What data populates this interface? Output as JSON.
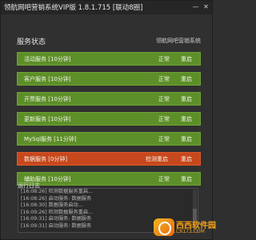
{
  "window": {
    "title": "领航网吧营销系统VIP版 1.8.1.715 [联动8圈]",
    "minimize_glyph": "—",
    "close_glyph": "✕"
  },
  "header": {
    "section_title": "服务状态",
    "brand_label": "领航网吧营销系统"
  },
  "services": [
    {
      "name": "活动服务 [10分钟]",
      "status": "正常",
      "restart": "重启",
      "alert": false
    },
    {
      "name": "客户服务 [10分钟]",
      "status": "正常",
      "restart": "重启",
      "alert": false
    },
    {
      "name": "开票服务 [10分钟]",
      "status": "正常",
      "restart": "重启",
      "alert": false
    },
    {
      "name": "更新服务 [10分钟]",
      "status": "正常",
      "restart": "重启",
      "alert": false
    },
    {
      "name": "MySql服务 [11分钟]",
      "status": "正常",
      "restart": "重启",
      "alert": false
    },
    {
      "name": "数据服务 [0分钟]",
      "status": "检测重启",
      "restart": "重启",
      "alert": true
    },
    {
      "name": "辅助服务 [10分钟]",
      "status": "正常",
      "restart": "重启",
      "alert": false
    }
  ],
  "log": {
    "title": "运行日志",
    "lines": [
      "[16:08:26] 检测数据服务重启...",
      "[16:08:26] 启动服务: 数据服务",
      "[16:08:30] 数据服务启动...",
      "[16:09:26] 检测数据服务重启...",
      "[16:09:31] 启动服务: 数据服务",
      "[16:09:31] 启动服务: 数据服务"
    ]
  },
  "watermark": {
    "text": "西西软件园",
    "url": "CR173.COM"
  },
  "colors": {
    "ok_row": "#5d8f29",
    "alert_row": "#c8481d",
    "background": "#303030"
  },
  "icons": {
    "minimize": "minimize-icon",
    "close": "close-icon",
    "watermark_logo": "cr173-logo-icon"
  }
}
